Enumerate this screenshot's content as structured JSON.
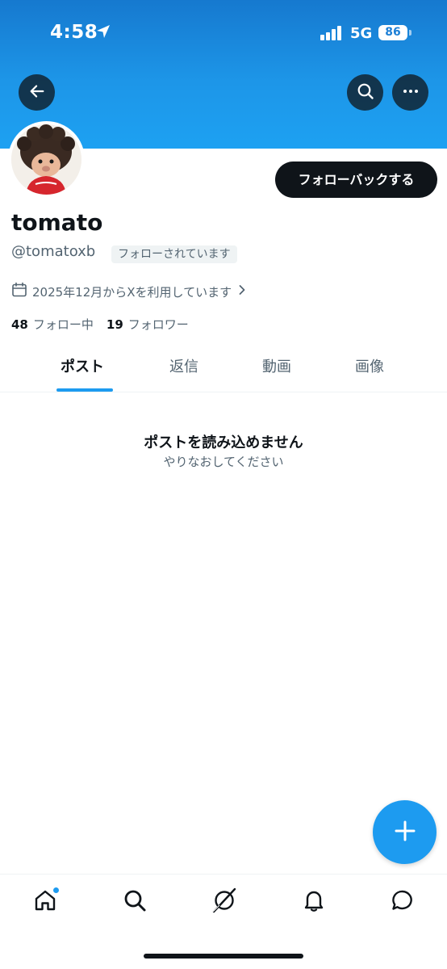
{
  "status_bar": {
    "time": "4:58",
    "network": "5G",
    "battery": "86"
  },
  "profile": {
    "display_name": "tomato",
    "handle": "@tomatoxb",
    "follows_you_badge": "フォローされています",
    "joined": "2025年12月からXを利用しています",
    "following_count": "48",
    "following_label": "フォロー中",
    "followers_count": "19",
    "followers_label": "フォロワー",
    "follow_back_label": "フォローバックする"
  },
  "tabs": [
    {
      "label": "ポスト",
      "active": true
    },
    {
      "label": "返信",
      "active": false
    },
    {
      "label": "動画",
      "active": false
    },
    {
      "label": "画像",
      "active": false
    }
  ],
  "empty_state": {
    "title": "ポストを読み込めません",
    "subtitle": "やりなおしてください"
  },
  "colors": {
    "banner": "#1d96e8",
    "accent": "#1d9bf0",
    "text_primary": "#0f1419",
    "text_secondary": "#536471"
  },
  "icons": {
    "header": [
      "back-arrow-icon",
      "search-icon",
      "more-icon"
    ],
    "nav": [
      "home-icon",
      "search-icon",
      "grok-icon",
      "bell-icon",
      "messages-icon"
    ],
    "fab": "plus-icon"
  }
}
